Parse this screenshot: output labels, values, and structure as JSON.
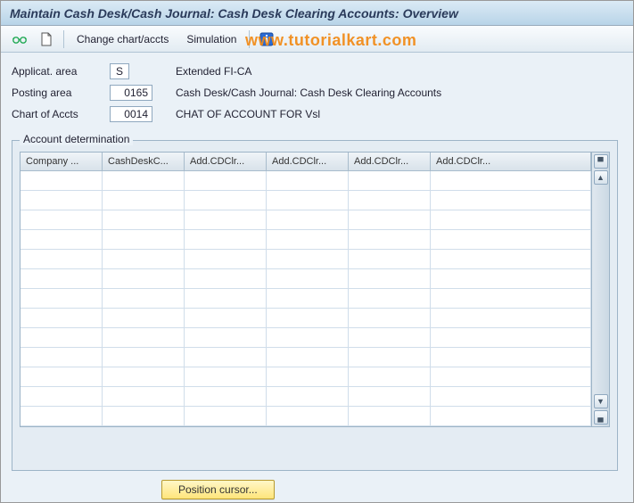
{
  "title": "Maintain Cash Desk/Cash Journal: Cash Desk Clearing Accounts: Overview",
  "toolbar": {
    "change_chart_accts": "Change chart/accts",
    "simulation": "Simulation"
  },
  "watermark": "www.tutorialkart.com",
  "fields": {
    "applicat_area": {
      "label": "Applicat. area",
      "value": "S",
      "desc": "Extended FI-CA"
    },
    "posting_area": {
      "label": "Posting area",
      "value": "0165",
      "desc": "Cash Desk/Cash Journal: Cash Desk Clearing Accounts"
    },
    "chart_of_accts": {
      "label": "Chart of Accts",
      "value": "0014",
      "desc": "CHAT OF ACCOUNT FOR Vsl"
    }
  },
  "panel": {
    "title": "Account determination",
    "columns": [
      "Company ...",
      "CashDeskC...",
      "Add.CDClr...",
      "Add.CDClr...",
      "Add.CDClr...",
      "Add.CDClr..."
    ]
  },
  "buttons": {
    "position_cursor": "Position cursor..."
  }
}
